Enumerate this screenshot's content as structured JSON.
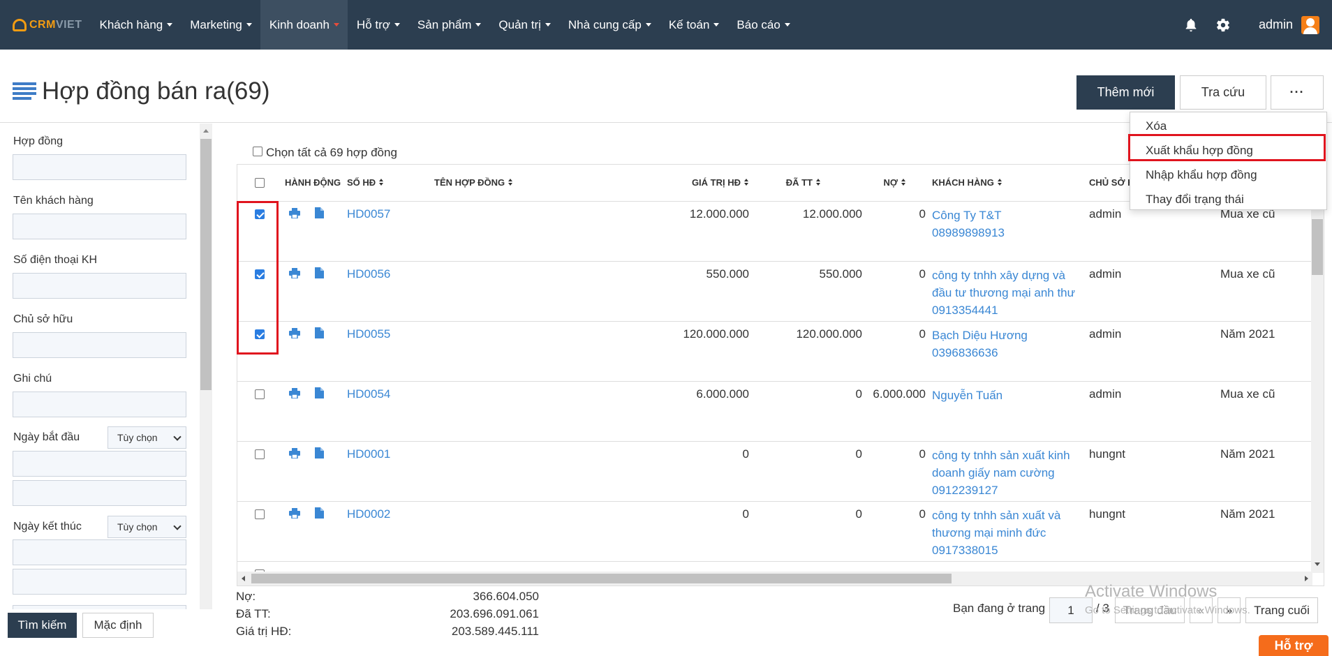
{
  "brand": {
    "part1": "CRM",
    "part2": "VIET"
  },
  "nav": {
    "items": [
      {
        "label": "Khách hàng"
      },
      {
        "label": "Marketing"
      },
      {
        "label": "Kinh doanh",
        "active": true
      },
      {
        "label": "Hỗ trợ"
      },
      {
        "label": "Sản phẩm"
      },
      {
        "label": "Quản trị"
      },
      {
        "label": "Nhà cung cấp"
      },
      {
        "label": "Kế toán"
      },
      {
        "label": "Báo cáo"
      }
    ],
    "user": "admin"
  },
  "header": {
    "title": "Hợp đồng bán ra(69)",
    "add_button": "Thêm mới",
    "search_button": "Tra cứu",
    "more_button": "···"
  },
  "dropdown": {
    "items": [
      "Xóa",
      "Xuất khẩu hợp đồng",
      "Nhập khẩu hợp đồng",
      "Thay đổi trạng thái"
    ]
  },
  "filters": {
    "contract_label": "Hợp đồng",
    "customer_name_label": "Tên khách hàng",
    "phone_label": "Số điện thoại KH",
    "owner_label": "Chủ sở hữu",
    "note_label": "Ghi chú",
    "start_date_label": "Ngày bắt đầu",
    "start_date_option": "Tùy chọn",
    "end_date_label": "Ngày kết thúc",
    "end_date_option": "Tùy chọn",
    "search_button": "Tìm kiếm",
    "reset_button": "Mặc định"
  },
  "table": {
    "select_all_label": "Chọn tất cả 69 hợp đồng",
    "columns": {
      "actions": "HÀNH ĐỘNG",
      "code": "SỐ HĐ",
      "name": "TÊN HỢP ĐỒNG",
      "value": "GIÁ TRỊ HĐ",
      "paid": "ĐÃ TT",
      "debt": "NỢ",
      "customer": "KHÁCH HÀNG",
      "owner": "CHỦ SỞ H"
    },
    "rows": [
      {
        "checked": true,
        "code": "HD0057",
        "value": "12.000.000",
        "paid": "12.000.000",
        "debt": "0",
        "customer": "Công Ty T&T",
        "phone": "08989898913",
        "owner": "admin",
        "status": "Mua xe cũ"
      },
      {
        "checked": true,
        "code": "HD0056",
        "value": "550.000",
        "paid": "550.000",
        "debt": "0",
        "customer": "công ty tnhh xây dựng và đầu tư thương mại anh thư",
        "phone": "0913354441",
        "owner": "admin",
        "status": "Mua xe cũ"
      },
      {
        "checked": true,
        "code": "HD0055",
        "value": "120.000.000",
        "paid": "120.000.000",
        "debt": "0",
        "customer": "Bạch Diệu Hương",
        "phone": "0396836636",
        "owner": "admin",
        "status": "Năm 2021"
      },
      {
        "checked": false,
        "code": "HD0054",
        "value": "6.000.000",
        "paid": "0",
        "debt": "6.000.000",
        "customer": "Nguyễn Tuấn",
        "phone": "",
        "owner": "admin",
        "status": "Mua xe cũ"
      },
      {
        "checked": false,
        "code": "HD0001",
        "value": "0",
        "paid": "0",
        "debt": "0",
        "customer": "công ty tnhh sản xuất kinh doanh giấy nam cường",
        "phone": "0912239127",
        "owner": "hungnt",
        "status": "Năm 2021"
      },
      {
        "checked": false,
        "code": "HD0002",
        "value": "0",
        "paid": "0",
        "debt": "0",
        "customer": "công ty tnhh sản xuất và thương mại minh đức",
        "phone": "0917338015",
        "owner": "hungnt",
        "status": "Năm 2021"
      }
    ]
  },
  "summary": {
    "debt_label": "Nợ:",
    "debt_value": "366.604.050",
    "paid_label": "Đã TT:",
    "paid_value": "203.696.091.061",
    "value_label": "Giá trị HĐ:",
    "value_value": "203.589.445.111"
  },
  "pagination": {
    "current_label": "Bạn đang ở trang",
    "current_page": "1",
    "total": "/ 3",
    "first": "Trang đầu",
    "prev": "«",
    "next": "»",
    "last": "Trang cuối"
  },
  "watermark": {
    "line1": "Activate Windows",
    "line2": "Go to Settings to activate Windows."
  },
  "help_button": "Hỗ trợ",
  "colors": {
    "navbar": "#2c3e50",
    "link": "#3a87d4",
    "highlight": "#e0141e",
    "help": "#f56c1b"
  }
}
